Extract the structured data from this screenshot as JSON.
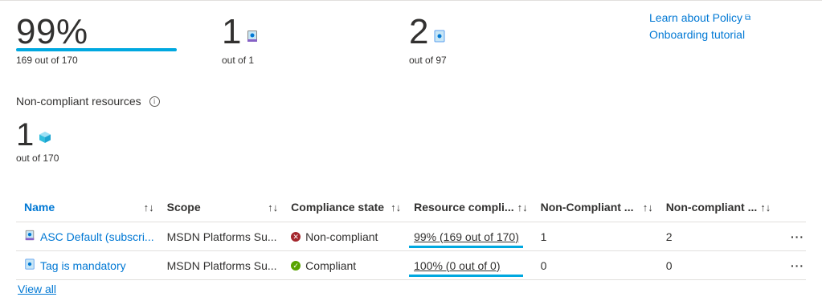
{
  "summary": {
    "overall": {
      "value": "99%",
      "sub": "169 out of 170",
      "fraction": 0.99
    },
    "assignments": {
      "value": "1",
      "sub": "out of 1"
    },
    "policies": {
      "value": "2",
      "sub": "out of 97"
    }
  },
  "links": {
    "learn": "Learn about Policy",
    "onboarding": "Onboarding tutorial"
  },
  "noncompliant": {
    "label": "Non-compliant resources",
    "value": "1",
    "sub": "out of 170"
  },
  "table": {
    "headers": [
      "Name",
      "Scope",
      "Compliance state",
      "Resource compli...",
      "Non-Compliant ...",
      "Non-compliant ..."
    ],
    "rows": [
      {
        "name": "ASC Default (subscri...",
        "scope": "MSDN Platforms Su...",
        "state": "Non-compliant",
        "state_color": "#a4262c",
        "resource": "99% (169 out of 170)",
        "nc1": "1",
        "nc2": "2",
        "more": "···"
      },
      {
        "name": "Tag is mandatory",
        "scope": "MSDN Platforms Su...",
        "state": "Compliant",
        "state_color": "#57a300",
        "resource": "100% (0 out of 0)",
        "nc1": "0",
        "nc2": "0",
        "more": "···"
      }
    ]
  },
  "view_all": "View all",
  "sort_glyph": "↑↓",
  "colors": {
    "accent": "#0078d4",
    "bar": "#00a8e0"
  }
}
